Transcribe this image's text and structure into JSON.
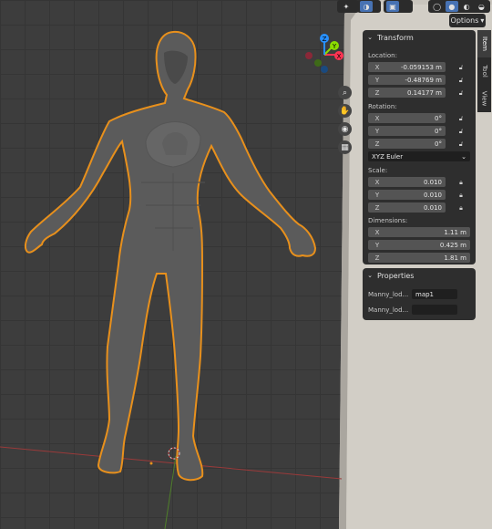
{
  "header": {
    "options_label": "Options",
    "icons": [
      "snap-icon",
      "overlay-icon",
      "xray-icon",
      "wireframe-shading-icon",
      "solid-shading-icon",
      "material-shading-icon",
      "rendered-shading-icon"
    ]
  },
  "gizmo": {
    "axes": [
      "X",
      "Y",
      "Z"
    ],
    "nav_icons": [
      "zoom-icon",
      "pan-hand-icon",
      "camera-icon",
      "grid-ortho-icon"
    ]
  },
  "tabs": [
    "Item",
    "Tool",
    "View"
  ],
  "transform": {
    "title": "Transform",
    "location_label": "Location:",
    "location": [
      {
        "axis": "X",
        "value": "-0.059153 m"
      },
      {
        "axis": "Y",
        "value": "-0.48769 m"
      },
      {
        "axis": "Z",
        "value": "0.14177 m"
      }
    ],
    "rotation_label": "Rotation:",
    "rotation": [
      {
        "axis": "X",
        "value": "0°"
      },
      {
        "axis": "Y",
        "value": "0°"
      },
      {
        "axis": "Z",
        "value": "0°"
      }
    ],
    "rotation_mode": "XYZ Euler",
    "scale_label": "Scale:",
    "scale": [
      {
        "axis": "X",
        "value": "0.010"
      },
      {
        "axis": "Y",
        "value": "0.010"
      },
      {
        "axis": "Z",
        "value": "0.010"
      }
    ],
    "dimensions_label": "Dimensions:",
    "dimensions": [
      {
        "axis": "X",
        "value": "1.11 m"
      },
      {
        "axis": "Y",
        "value": "0.425 m"
      },
      {
        "axis": "Z",
        "value": "1.81 m"
      }
    ]
  },
  "properties": {
    "title": "Properties",
    "rows": [
      {
        "label": "Manny_lod...",
        "value": "map1"
      },
      {
        "label": "Manny_lod...",
        "value": ""
      }
    ]
  },
  "colors": {
    "selection_outline": "#e8901c",
    "axis_x": "#ff3352",
    "axis_y": "#8bdc00",
    "axis_z": "#2890ff",
    "panel_bg": "#2e2e2e",
    "active_blue": "#4772b3"
  }
}
